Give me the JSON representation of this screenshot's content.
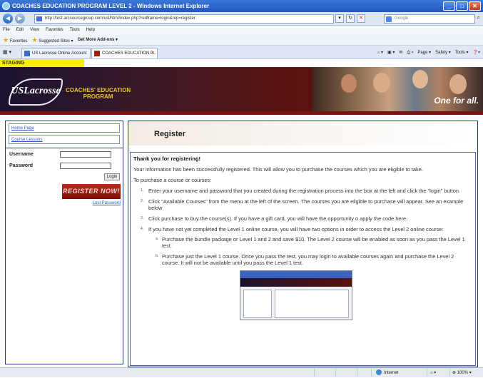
{
  "window": {
    "title": "COACHES EDUCATION PROGRAM LEVEL 2 - Windows Internet Explorer"
  },
  "address_bar": {
    "url": "http://test.arcsourcegroup.com/usl/html/index.php?redframe=login&rep=register",
    "search_placeholder": "Google"
  },
  "menu": [
    "File",
    "Edit",
    "View",
    "Favorites",
    "Tools",
    "Help"
  ],
  "favorites_bar": {
    "favorites": "Favorites",
    "suggested": "Suggested Sites ▾",
    "addons": "Get More Add-ons ▾"
  },
  "tabs": [
    {
      "label": "US Lacrosse Online Account -..."
    },
    {
      "label": "COACHES EDUCATION P...",
      "active": true
    }
  ],
  "command_bar": [
    "Page ▾",
    "Safety ▾",
    "Tools ▾"
  ],
  "site": {
    "staging": "STAGING",
    "logo": "USLacrosse",
    "program_line1": "COACHES' EDUCATION",
    "program_line2": "PROGRAM",
    "tagline": "One for all."
  },
  "sidebar": {
    "nav": [
      "Home Page",
      "Course Lessons"
    ],
    "username_label": "Username",
    "password_label": "Password",
    "login_button": "Login",
    "register_button": "REGISTER NOW!",
    "lost_password": "Lost Password"
  },
  "main": {
    "heading": "Register",
    "thanks": "Thank you for registering!",
    "intro": "Your information has been successfully registered. This will allow you to purchase the courses which you are eligible to take.",
    "purchase_intro": "To purchase a course or courses:",
    "steps": [
      {
        "n": "1.",
        "text": "Enter your username and password that you created during the registration process into the box at the left and click the \"login\" button."
      },
      {
        "n": "2.",
        "text": "Click \"Available Courses\" from the menu at the left of the screen. The courses you are eligible to purchase will appear. See an example below"
      },
      {
        "n": "3.",
        "text": "Click purchase to buy the course(s). If you have a gift card, you will have the opportunity o apply the code here."
      },
      {
        "n": "4.",
        "text": "If you have not yet completed the Level 1 online course, you will have two options in order to access the Level 2 online course:"
      }
    ],
    "substeps": [
      {
        "n": "a.",
        "text": "Purchase the bundle package or Level 1 and 2 and save $10. The Level 2 course will be enabled as soon as you pass the Level 1 test."
      },
      {
        "n": "b.",
        "text": "Purchase just the Level 1 course. Once you pass the test, you may login to available courses again and purchase the Level 2 course. It will not be available until you pass the Level 1 test."
      }
    ]
  },
  "status_bar": {
    "zone": "Internet",
    "zoom": "100%"
  }
}
